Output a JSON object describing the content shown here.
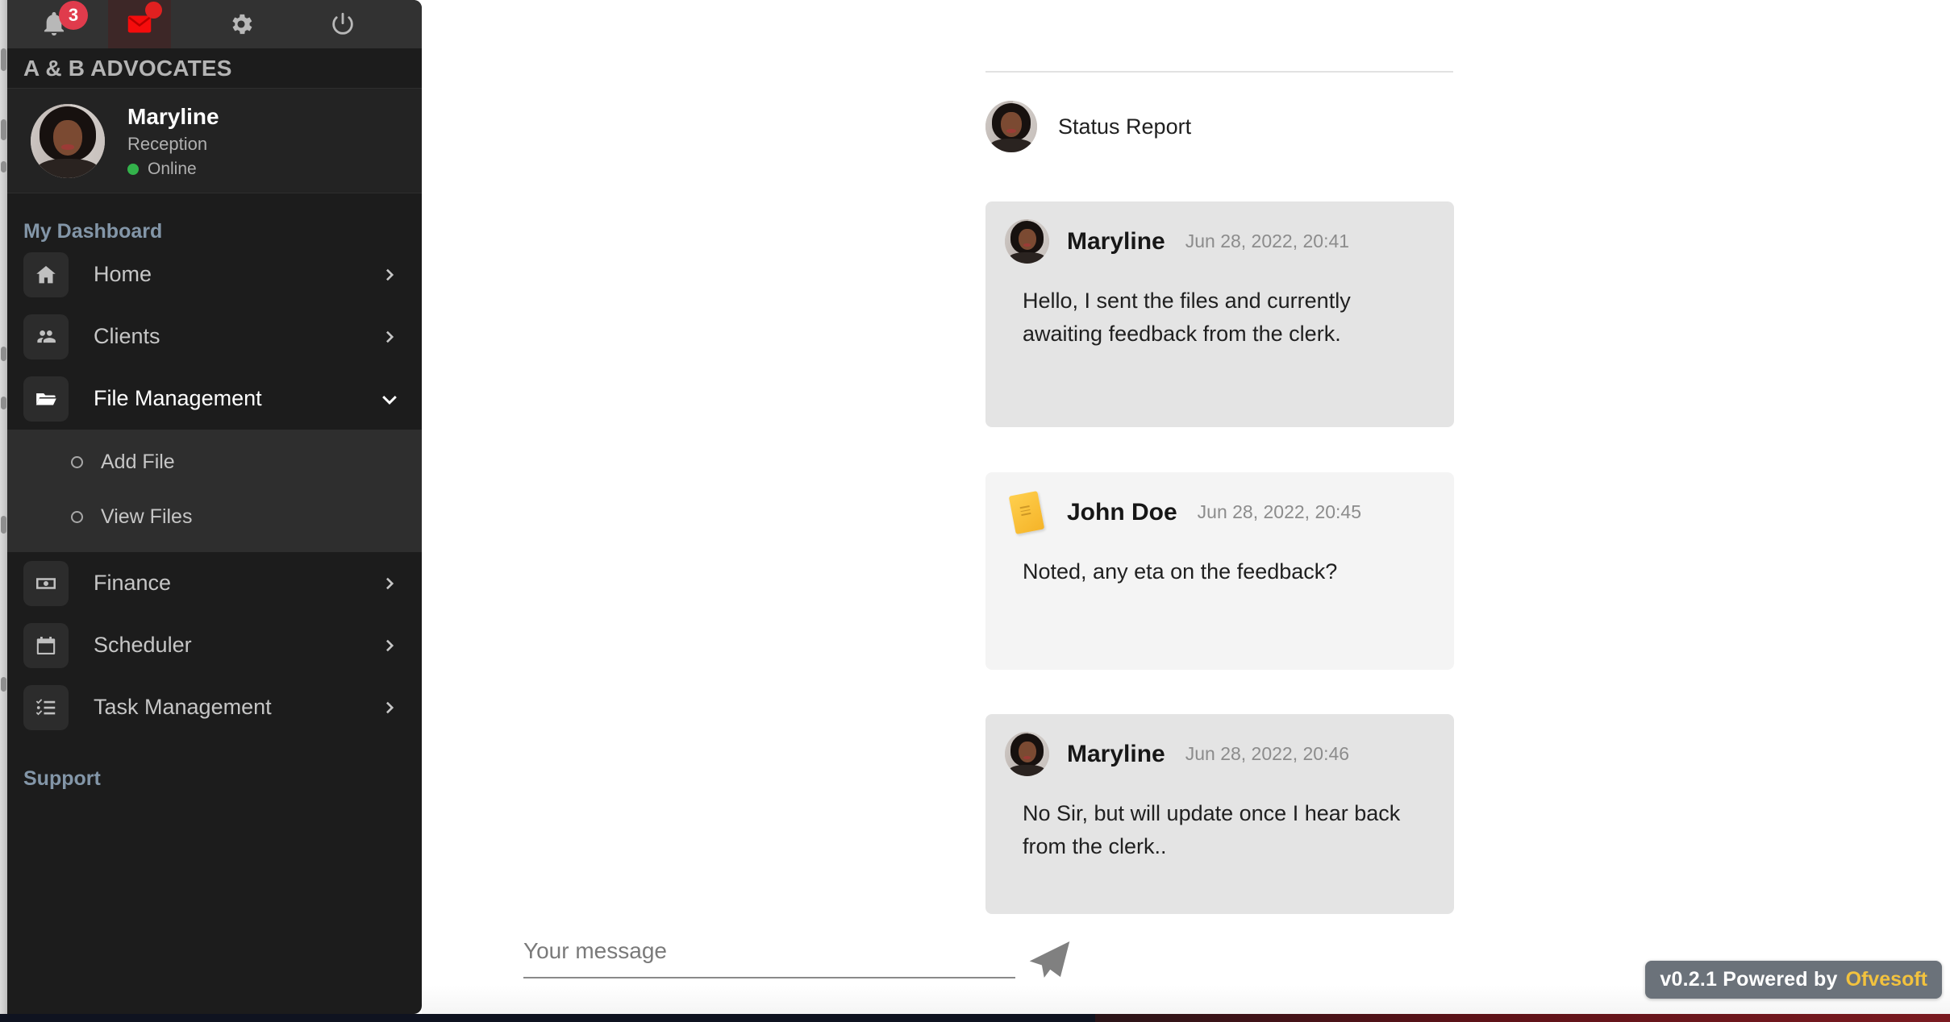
{
  "topbar": {
    "notifications": {
      "icon": "bell-icon",
      "count": "3"
    },
    "mail": {
      "icon": "mail-icon",
      "has_unread_dot": true
    },
    "settings": {
      "icon": "gear-icon"
    },
    "power": {
      "icon": "power-icon"
    }
  },
  "brand": {
    "name": "A & B ADVOCATES"
  },
  "profile": {
    "name": "Maryline",
    "role": "Reception",
    "status": "Online",
    "status_color": "#33b24b",
    "avatar": "user-avatar"
  },
  "sidebar": {
    "sections": [
      {
        "title": "My Dashboard"
      },
      {
        "title": "Support"
      }
    ],
    "items": [
      {
        "label": "Home",
        "icon": "home-icon",
        "chevron": "chevron-right-icon",
        "active": false
      },
      {
        "label": "Clients",
        "icon": "people-icon",
        "chevron": "chevron-right-icon",
        "active": false
      },
      {
        "label": "File Management",
        "icon": "folder-open-icon",
        "chevron": "chevron-down-icon",
        "active": true
      },
      {
        "label": "Finance",
        "icon": "money-icon",
        "chevron": "chevron-right-icon",
        "active": false
      },
      {
        "label": "Scheduler",
        "icon": "calendar-icon",
        "chevron": "chevron-right-icon",
        "active": false
      },
      {
        "label": "Task Management",
        "icon": "checklist-icon",
        "chevron": "chevron-right-icon",
        "active": false
      }
    ],
    "submenu": [
      {
        "label": "Add File",
        "bullet": "circle-bullet-icon"
      },
      {
        "label": "View Files",
        "bullet": "circle-bullet-icon"
      }
    ]
  },
  "chat": {
    "thread_title": "Status Report",
    "thread_avatar": "user-avatar",
    "messages": [
      {
        "sender": "Maryline",
        "timestamp": "Jun 28, 2022, 20:41",
        "text": "Hello, I sent the files and currently awaiting feedback from the clerk.",
        "avatar_type": "photo",
        "bubble_color": "#e4e4e4"
      },
      {
        "sender": "John Doe",
        "timestamp": "Jun 28, 2022, 20:45",
        "text": "Noted, any eta on the feedback?",
        "avatar_type": "note-card",
        "bubble_color": "#f4f4f4"
      },
      {
        "sender": "Maryline",
        "timestamp": "Jun 28, 2022, 20:46",
        "text": "No Sir, but will update once I hear back from the clerk..",
        "avatar_type": "photo",
        "bubble_color": "#e4e4e4"
      }
    ]
  },
  "composer": {
    "placeholder": "Your message",
    "value": "",
    "send_icon": "send-paper-plane-icon"
  },
  "watermark": {
    "text": "v0.2.1 Powered by",
    "brand": "Ofvesoft",
    "brand_color": "#f2c23e"
  }
}
